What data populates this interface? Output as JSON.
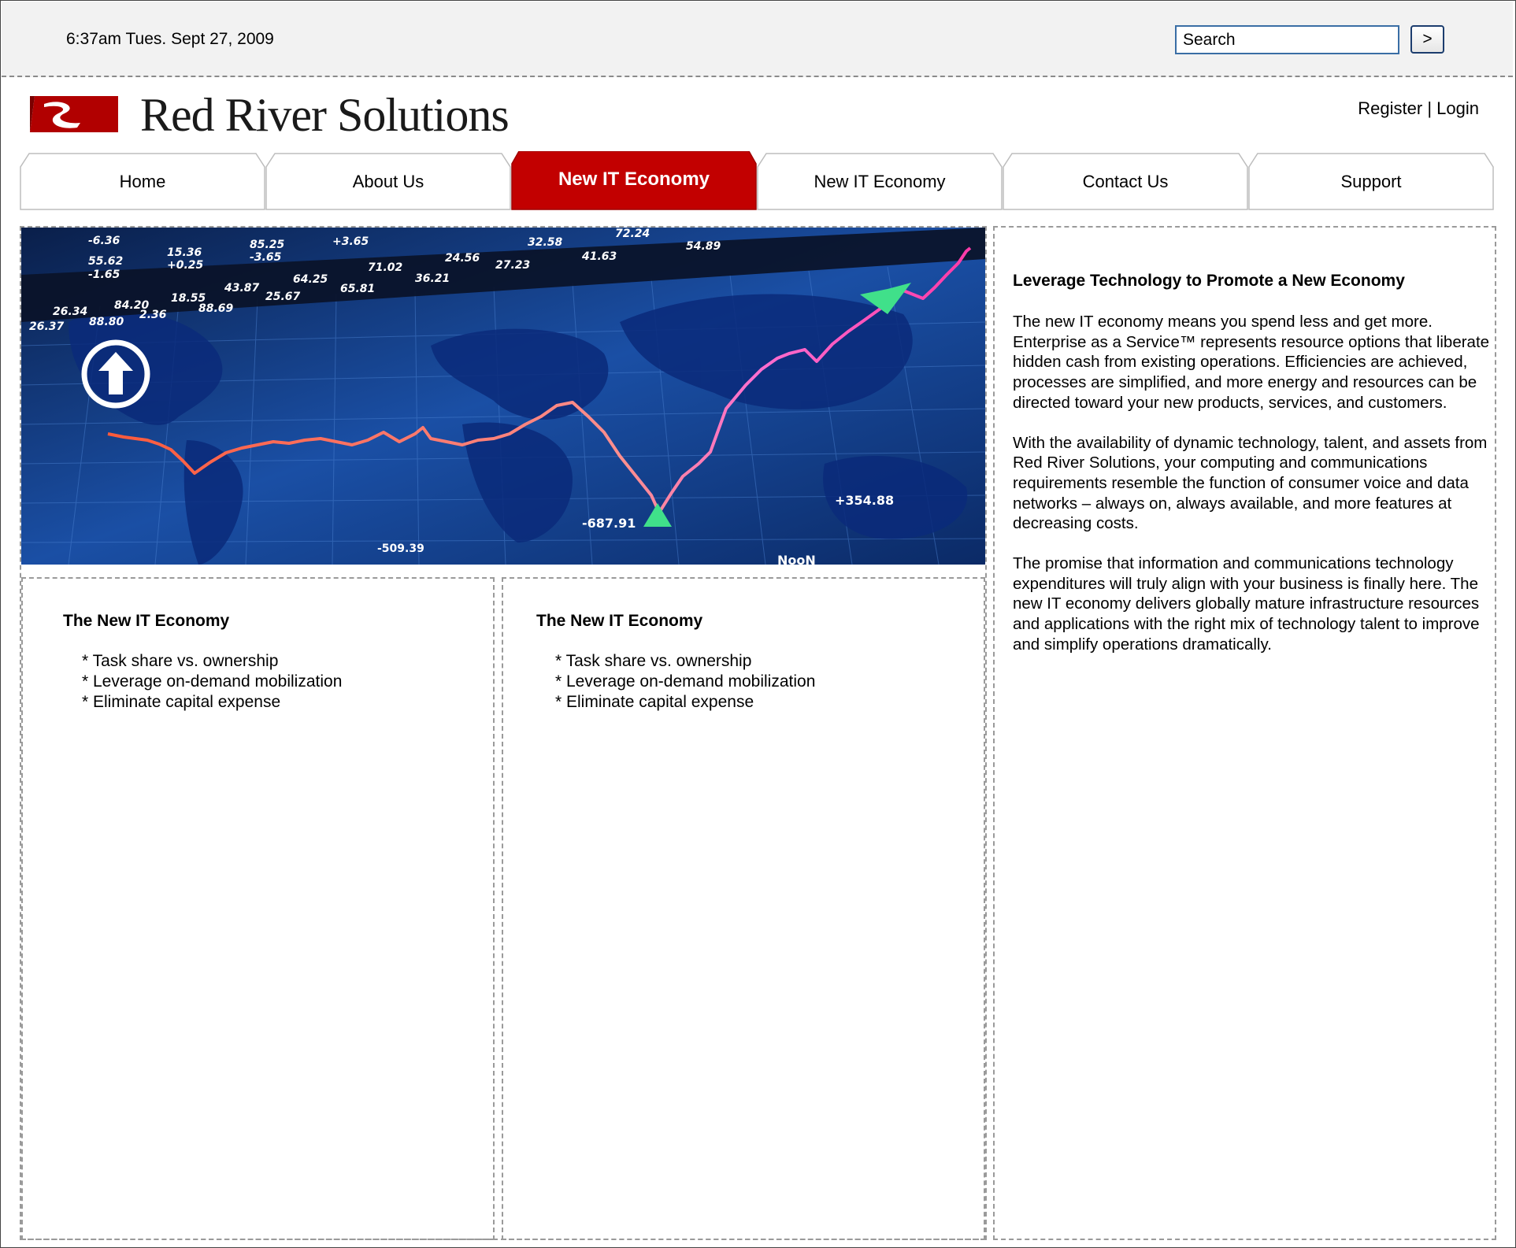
{
  "topbar": {
    "datetime": "6:37am Tues. Sept 27, 2009",
    "search_placeholder": "Search",
    "search_button": ">"
  },
  "brand": {
    "name": "Red River Solutions",
    "logo_color": "#c00000"
  },
  "account": {
    "register": "Register",
    "separator": "|",
    "login": "Login"
  },
  "nav": {
    "active_color": "#c20000",
    "items": [
      {
        "label": "Home"
      },
      {
        "label": "About Us"
      },
      {
        "label": "New IT Economy",
        "active": true
      },
      {
        "label": "New IT Economy"
      },
      {
        "label": "Contact Us"
      },
      {
        "label": "Support"
      }
    ]
  },
  "hero": {
    "description_icon": "world-market-chart-image",
    "labels": [
      "-687.91",
      "-509.39",
      "+354.88",
      "NooN",
      "54.89",
      "41.63",
      "32.58",
      "27.23",
      "24.56",
      "36.21",
      "71.02",
      "65.81",
      "64.25",
      "25.67",
      "43.87",
      "85.25",
      "-3.65",
      "+3.65",
      "72.24",
      "15.36",
      "+0.25",
      "55.62",
      "-1.65",
      "-6.36",
      "18.55",
      "84.20",
      "2.36",
      "88.69",
      "26.34",
      "88.80",
      "26.37"
    ]
  },
  "cards": [
    {
      "title": "The New IT Economy",
      "bullets": [
        "* Task share vs. ownership",
        "* Leverage on-demand mobilization",
        "* Eliminate capital expense"
      ]
    },
    {
      "title": "The New IT Economy",
      "bullets": [
        "* Task share vs. ownership",
        "* Leverage on-demand mobilization",
        "* Eliminate capital expense"
      ]
    }
  ],
  "aside": {
    "title": "Leverage Technology to Promote a New Economy",
    "paragraphs": [
      "The new IT economy means you spend less and get more. Enterprise as a Service™ represents resource options that liberate hidden cash from existing operations. Efficiencies are achieved, processes are simplified, and more energy and resources can be directed toward your new products, services, and customers.",
      "With the availability of dynamic technology, talent, and assets from Red River Solutions, your computing and communications requirements resemble the function of consumer voice and data networks – always on, always available, and more features at decreasing costs.",
      "The promise that information and communications technology expenditures will truly align with your business is finally here. The new IT economy delivers globally mature infrastructure resources and applications with the right mix of technology talent to improve and simplify operations dramatically."
    ]
  }
}
